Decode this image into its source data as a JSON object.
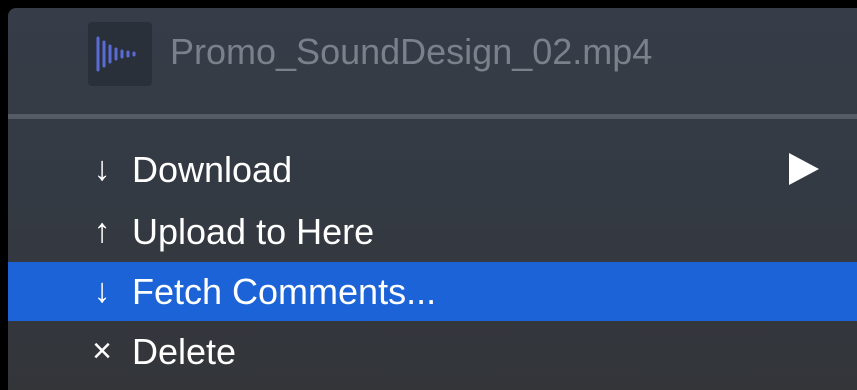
{
  "file": {
    "name": "Promo_SoundDesign_02.mp4",
    "icon": "audio-waveform-icon"
  },
  "menu": {
    "items": [
      {
        "glyph": "↓",
        "icon": "download-arrow-icon",
        "label": "Download",
        "has_submenu": true,
        "highlighted": false
      },
      {
        "glyph": "↑",
        "icon": "upload-arrow-icon",
        "label": "Upload to Here",
        "has_submenu": false,
        "highlighted": false
      },
      {
        "glyph": "↓",
        "icon": "fetch-arrow-icon",
        "label": "Fetch Comments...",
        "has_submenu": false,
        "highlighted": true
      },
      {
        "glyph": "×",
        "icon": "delete-x-icon",
        "label": "Delete",
        "has_submenu": false,
        "highlighted": false
      }
    ]
  },
  "colors": {
    "highlight": "#1c63d8",
    "menu_background": "#363d48",
    "file_name_text": "#7b808a",
    "icon_waveform": "#5b6bd6"
  }
}
